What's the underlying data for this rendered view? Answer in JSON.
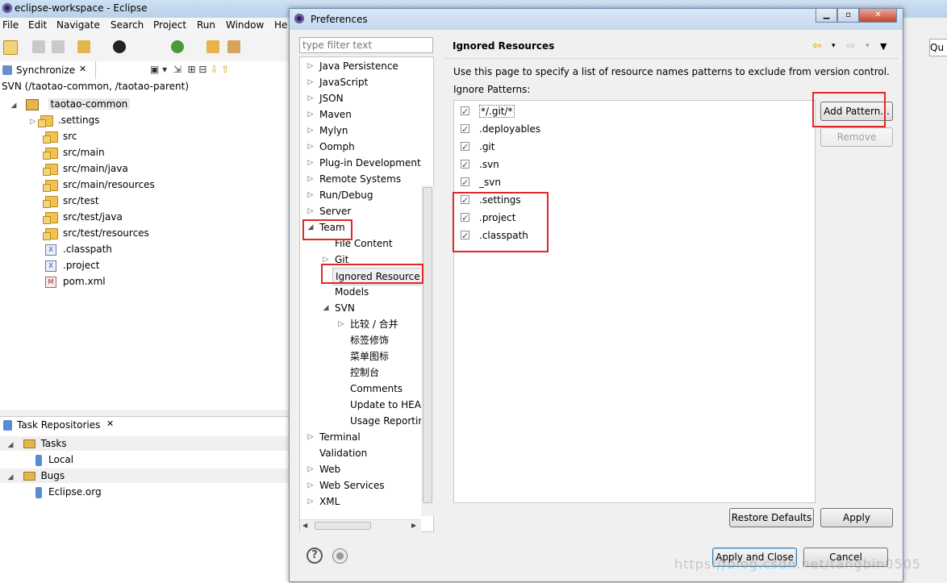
{
  "eclipse": {
    "title": "eclipse-workspace - Eclipse",
    "menu": [
      "File",
      "Edit",
      "Navigate",
      "Search",
      "Project",
      "Run",
      "Window",
      "He"
    ],
    "sync_tab": "Synchronize",
    "sync_header": "SVN (/taotao-common, /taotao-parent)",
    "tree": {
      "project": "taotao-common",
      "items": [
        ".settings",
        "src",
        "src/main",
        "src/main/java",
        "src/main/resources",
        "src/test",
        "src/test/java",
        "src/test/resources",
        ".classpath",
        ".project",
        "pom.xml"
      ]
    },
    "task_tab": "Task Repositories",
    "tasks": {
      "tasks_label": "Tasks",
      "local": "Local",
      "bugs_label": "Bugs",
      "eclipse_org": "Eclipse.org"
    },
    "quick_access": "Qu"
  },
  "dialog": {
    "title": "Preferences",
    "filter_placeholder": "type filter text",
    "nav": {
      "java_persistence": "Java Persistence",
      "javascript": "JavaScript",
      "json": "JSON",
      "maven": "Maven",
      "mylyn": "Mylyn",
      "oomph": "Oomph",
      "plugin_dev": "Plug-in Development",
      "remote_systems": "Remote Systems",
      "run_debug": "Run/Debug",
      "server": "Server",
      "team": "Team",
      "file_content": "File Content",
      "git": "Git",
      "ignored_resources": "Ignored Resource",
      "models": "Models",
      "svn": "SVN",
      "svn_compare": "比较 / 合并",
      "svn_label": "标签修饰",
      "svn_menu": "菜单图标",
      "svn_console": "控制台",
      "svn_comments": "Comments",
      "svn_update": "Update to HEA",
      "svn_usage": "Usage Reportin",
      "terminal": "Terminal",
      "validation": "Validation",
      "web": "Web",
      "web_services": "Web Services",
      "xml": "XML"
    },
    "page_title": "Ignored Resources",
    "description": "Use this page to specify a list of resource names patterns to exclude from version control.",
    "ignore_label": "Ignore Patterns:",
    "patterns": [
      "*/.git/*",
      ".deployables",
      ".git",
      ".svn",
      "_svn",
      ".settings",
      ".project",
      ".classpath"
    ],
    "buttons": {
      "add_pattern": "Add Pattern...",
      "remove": "Remove",
      "restore_defaults": "Restore Defaults",
      "apply": "Apply",
      "apply_close": "Apply and Close",
      "cancel": "Cancel"
    },
    "watermark": "https://blog.csdn.net/tangbin0505"
  },
  "colors": {
    "highlight_box": "#e2262a",
    "title_bar": "#c4d8ee"
  }
}
